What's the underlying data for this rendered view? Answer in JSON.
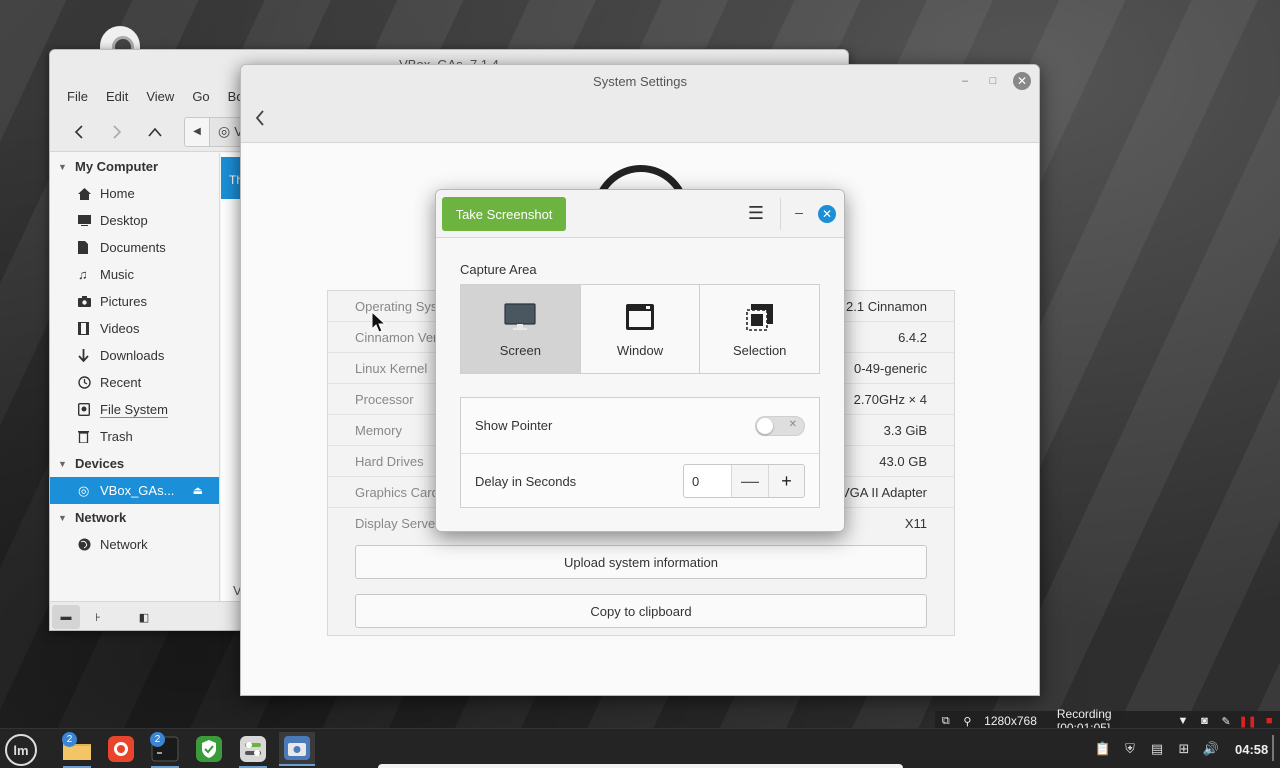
{
  "desktop": {
    "fm": {
      "title": "VBox_GAs_7.1.4",
      "menu": [
        "File",
        "Edit",
        "View",
        "Go",
        "Book"
      ],
      "path_segment": "V",
      "sidebar": {
        "my_computer": "My Computer",
        "items": [
          {
            "label": "Home",
            "icon": "home-icon"
          },
          {
            "label": "Desktop",
            "icon": "desktop-icon"
          },
          {
            "label": "Documents",
            "icon": "document-icon"
          },
          {
            "label": "Music",
            "icon": "music-icon"
          },
          {
            "label": "Pictures",
            "icon": "camera-icon"
          },
          {
            "label": "Videos",
            "icon": "film-icon"
          },
          {
            "label": "Downloads",
            "icon": "download-icon"
          },
          {
            "label": "Recent",
            "icon": "clock-icon"
          },
          {
            "label": "File System",
            "icon": "drive-icon"
          },
          {
            "label": "Trash",
            "icon": "trash-icon"
          }
        ],
        "devices": "Devices",
        "device_item": "VBox_GAs...",
        "network": "Network",
        "network_item": "Network"
      },
      "content_banner": "Th",
      "content_text": "V"
    },
    "settings": {
      "title": "System Settings",
      "info": [
        {
          "key": "Operating Sys",
          "value": "2.1 Cinnamon"
        },
        {
          "key": "Cinnamon Ver",
          "value": "6.4.2"
        },
        {
          "key": "Linux Kernel",
          "value": "0-49-generic"
        },
        {
          "key": "Processor",
          "value": "2.70GHz × 4"
        },
        {
          "key": "Memory",
          "value": "3.3 GiB"
        },
        {
          "key": "Hard Drives",
          "value": "43.0 GB"
        },
        {
          "key": "Graphics Card",
          "value": "VGA II Adapter"
        },
        {
          "key": "Display Server",
          "value": "X11"
        }
      ],
      "upload_btn": "Upload system information",
      "copy_btn": "Copy to clipboard"
    },
    "screenshot": {
      "take_btn": "Take Screenshot",
      "capture_area_label": "Capture Area",
      "modes": [
        {
          "label": "Screen",
          "selected": true
        },
        {
          "label": "Window",
          "selected": false
        },
        {
          "label": "Selection",
          "selected": false
        }
      ],
      "show_pointer_label": "Show Pointer",
      "show_pointer_on": false,
      "delay_label": "Delay in Seconds",
      "delay_value": "0",
      "accent": "#6cb33f"
    },
    "recording": {
      "resolution": "1280x768",
      "status": "Recording [00:01:05]"
    },
    "taskbar": {
      "menu_logo": "lm",
      "apps": [
        {
          "name": "files",
          "badge": "2"
        },
        {
          "name": "firefox",
          "badge": ""
        },
        {
          "name": "terminal",
          "badge": "2"
        },
        {
          "name": "update-manager",
          "badge": ""
        },
        {
          "name": "system-settings",
          "badge": ""
        },
        {
          "name": "screenshot",
          "badge": ""
        }
      ],
      "clock": "04:58"
    }
  }
}
